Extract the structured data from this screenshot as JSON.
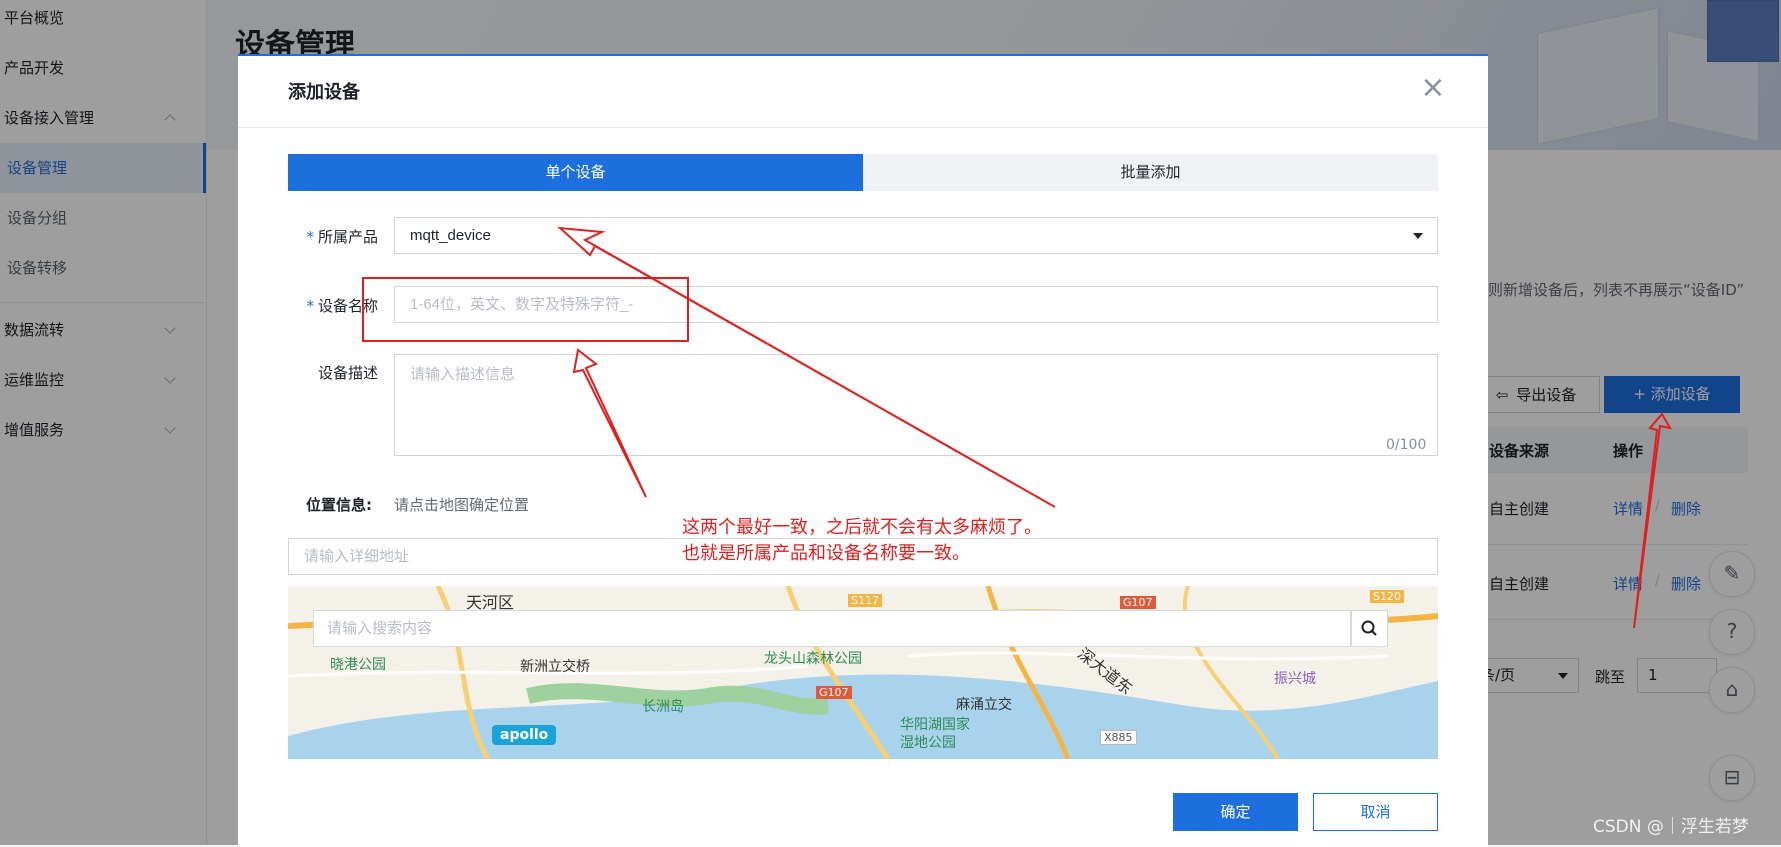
{
  "sidebar": {
    "items": [
      {
        "label": "平台概览"
      },
      {
        "label": "产品开发"
      },
      {
        "label": "设备接入管理"
      },
      {
        "label": "设备管理"
      },
      {
        "label": "设备分组"
      },
      {
        "label": "设备转移"
      },
      {
        "label": "数据流转"
      },
      {
        "label": "运维监控"
      },
      {
        "label": "增值服务"
      }
    ]
  },
  "background": {
    "page_title": "设备管理",
    "notice_fragment": "则新增设备后，列表不再展示“设备ID”",
    "export_label": "导出设备",
    "add_label": "+ 添加设备",
    "table": {
      "headers": [
        "设备来源",
        "操作"
      ],
      "rows": [
        {
          "source": "自主创建",
          "detail": "详情",
          "delete": "删除"
        },
        {
          "source": "自主创建",
          "detail": "详情",
          "delete": "删除"
        }
      ],
      "separator": "/"
    },
    "pagination": {
      "per_page": "条/页",
      "jump_label": "跳至",
      "jump_value": "1"
    }
  },
  "modal": {
    "title": "添加设备",
    "tabs": [
      {
        "label": "单个设备"
      },
      {
        "label": "批量添加"
      }
    ],
    "product_label": "所属产品",
    "product_value": "mqtt_device",
    "name_label": "设备名称",
    "name_placeholder": "1-64位，英文、数字及特殊字符_-",
    "desc_label": "设备描述",
    "desc_placeholder": "请输入描述信息",
    "desc_counter": "0/100",
    "location_label": "位置信息:",
    "location_hint": "请点击地图确定位置",
    "address_placeholder": "请输入详细地址",
    "map": {
      "search_placeholder": "请输入搜索内容",
      "labels": [
        "天河区",
        "晓港公园",
        "新洲立交桥",
        "龙头山森林公园",
        "长洲岛",
        "麻涌立交",
        "华阳湖国家",
        "湿地公园",
        "振兴城",
        "深大道东"
      ],
      "roads": [
        "S117",
        "G107",
        "G107",
        "S120",
        "X885"
      ],
      "logo": "apollo"
    },
    "ok_label": "确定",
    "cancel_label": "取消"
  },
  "annotation": {
    "line1": "这两个最好一致，之后就不会有太多麻烦了。",
    "line2": "也就是所属产品和设备名称要一致。",
    "color": "#e02020"
  },
  "watermark": "CSDN @｜浮生若梦",
  "colors": {
    "accent": "#1e6fde"
  }
}
